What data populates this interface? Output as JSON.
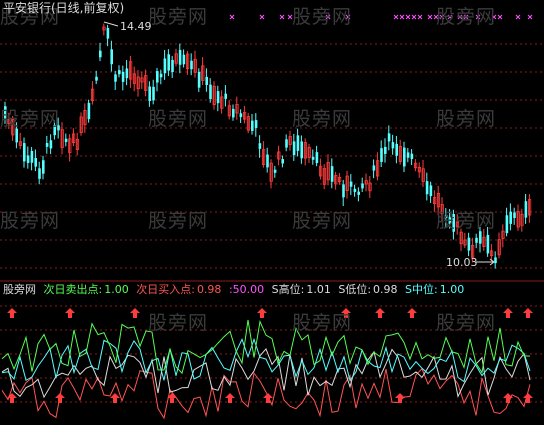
{
  "top_panel": {
    "title": "平安银行(日线,前复权)",
    "high_annotation": "14.49",
    "low_annotation": "10.03"
  },
  "bottom_panel": {
    "name": "股旁网",
    "sell_label": "次日卖出点:",
    "sell_value": "1.00",
    "buy_label": "次日买入点:",
    "buy_value": "0.98",
    "extra_value": ":50.00",
    "s_high_label": "S高位:",
    "s_high_value": "1.01",
    "s_low_label": "S低位:",
    "s_low_value": "0.98",
    "s_mid_label": "S中位:",
    "s_mid_value": "1.00"
  },
  "watermark": "股旁网",
  "colors": {
    "up": "#ff3c3c",
    "down": "#54ffff",
    "grid": "#8b1a1a",
    "sell": "#ffff54",
    "buy": "#ff5454",
    "pink": "#ff54ff",
    "white": "#dcdcdc",
    "green": "#54ff54",
    "cyan": "#54ffff",
    "arrow": "#ff3c3c"
  }
}
